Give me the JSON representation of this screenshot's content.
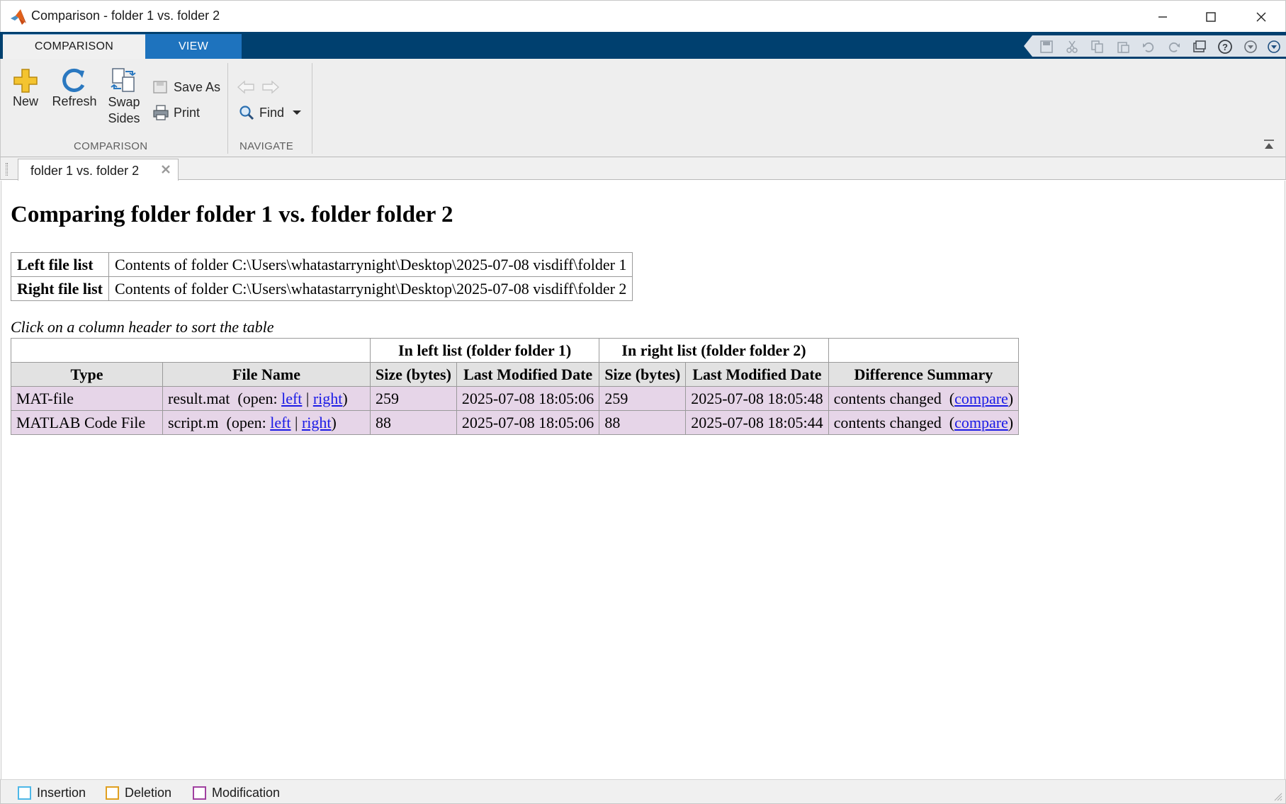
{
  "window": {
    "title": "Comparison - folder 1 vs. folder 2",
    "logo_icon": "matlab-logo-icon",
    "controls": [
      "minimize-icon",
      "maximize-icon",
      "close-icon"
    ]
  },
  "ribbon": {
    "tabs": [
      {
        "label": "COMPARISON",
        "active": true
      },
      {
        "label": "VIEW",
        "active": false
      }
    ],
    "quick_access_icons": [
      "save-icon",
      "cut-icon",
      "copy-icon",
      "paste-icon",
      "undo-icon",
      "redo-icon",
      "switch-windows-icon",
      "help-icon",
      "options-icon",
      "collapse-icon"
    ],
    "groups": {
      "comparison": {
        "label": "COMPARISON",
        "new_label": "New",
        "refresh_label": "Refresh",
        "swap_label_line1": "Swap",
        "swap_label_line2": "Sides",
        "save_as_label": "Save As",
        "print_label": "Print"
      },
      "navigate": {
        "label": "NAVIGATE",
        "find_label": "Find"
      }
    }
  },
  "document_tab": {
    "label": "folder 1 vs. folder 2"
  },
  "content": {
    "heading": "Comparing folder folder 1 vs. folder folder 2",
    "lists": [
      {
        "label": "Left file list",
        "value": "Contents of folder C:\\Users\\whatastarrynight\\Desktop\\2025-07-08 visdiff\\folder 1"
      },
      {
        "label": "Right file list",
        "value": "Contents of folder C:\\Users\\whatastarrynight\\Desktop\\2025-07-08 visdiff\\folder 2"
      }
    ],
    "hint": "Click on a column header to sort the table",
    "table": {
      "group_left": "In left list  (folder folder 1)",
      "group_right": "In right list  (folder folder 2)",
      "headers": {
        "type": "Type",
        "file_name": "File Name",
        "left_size": "Size (bytes)",
        "left_date": "Last Modified Date",
        "right_size": "Size (bytes)",
        "right_date": "Last Modified Date",
        "summary": "Difference Summary"
      },
      "open_prefix": "(open: ",
      "left_link": "left",
      "link_sep": " | ",
      "right_link": "right",
      "open_suffix": ")",
      "compare_link": "compare",
      "rows": [
        {
          "type": "MAT-file",
          "file": "result.mat",
          "left_size": "259",
          "left_date": "2025-07-08 18:05:06",
          "right_size": "259",
          "right_date": "2025-07-08 18:05:48",
          "summary": "contents changed"
        },
        {
          "type": "MATLAB Code File",
          "file": "script.m",
          "left_size": "88",
          "left_date": "2025-07-08 18:05:06",
          "right_size": "88",
          "right_date": "2025-07-08 18:05:44",
          "summary": "contents changed"
        }
      ]
    }
  },
  "legend": {
    "insertion": {
      "label": "Insertion",
      "color": "#4db8e8"
    },
    "deletion": {
      "label": "Deletion",
      "color": "#e0a020"
    },
    "modification": {
      "label": "Modification",
      "color": "#a040a0"
    }
  },
  "colors": {
    "ribbon_strip": "#00406f",
    "view_tab": "#1e73be",
    "modified_row": "#e6d5e8",
    "link": "#1a1ae6"
  }
}
